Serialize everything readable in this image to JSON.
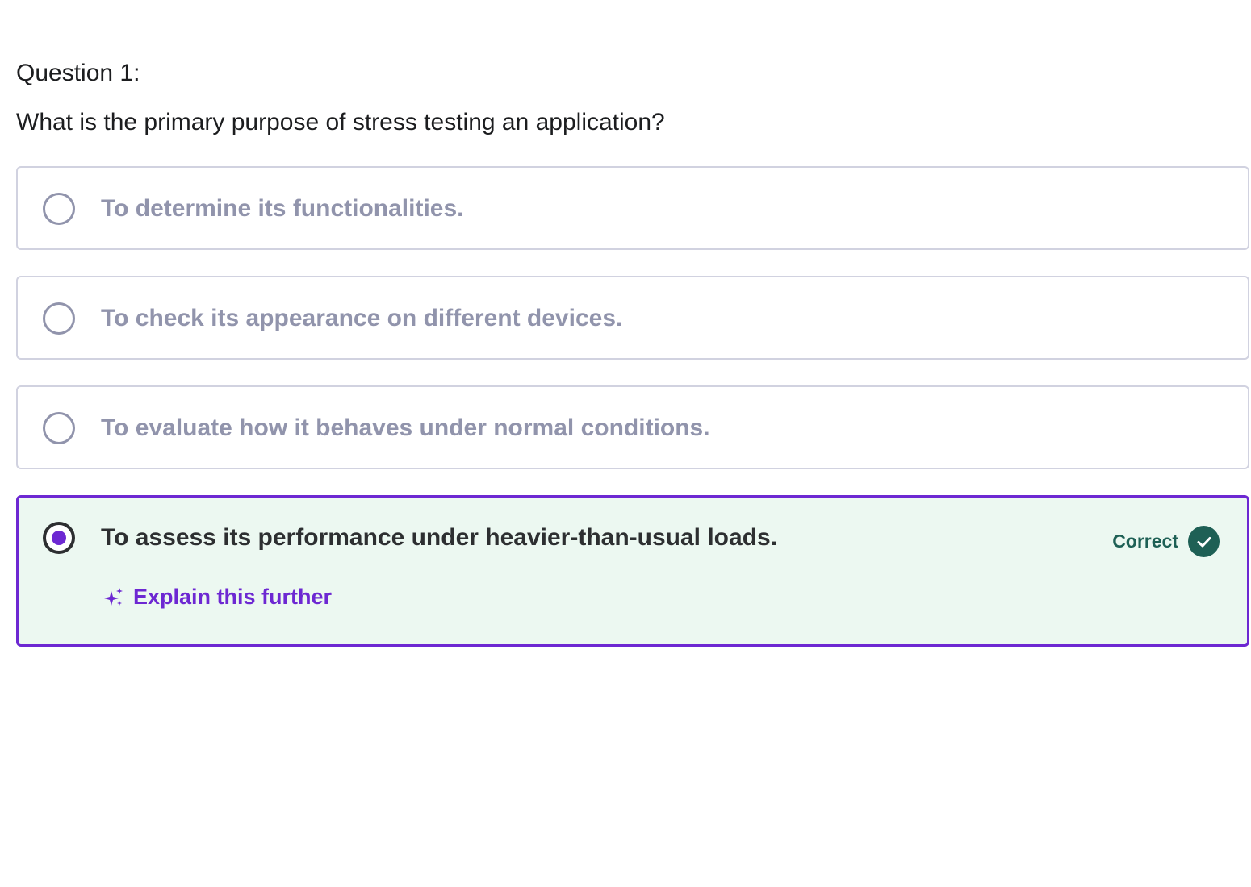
{
  "question": {
    "number_label": "Question 1:",
    "text": "What is the primary purpose of stress testing an application?"
  },
  "options": [
    {
      "text": "To determine its functionalities.",
      "selected": false
    },
    {
      "text": "To check its appearance on different devices.",
      "selected": false
    },
    {
      "text": "To evaluate how it behaves under normal conditions.",
      "selected": false
    },
    {
      "text": "To assess its performance under heavier-than-usual loads.",
      "selected": true
    }
  ],
  "result": {
    "label": "Correct",
    "icon": "check-circle-icon"
  },
  "explain": {
    "label": "Explain this further",
    "icon": "sparkle-icon"
  },
  "colors": {
    "accent": "#6d28d2",
    "correct": "#1e6055",
    "correct_bg": "#ecf8f1",
    "muted_text": "#9194ac",
    "border": "#d1d2e0"
  }
}
